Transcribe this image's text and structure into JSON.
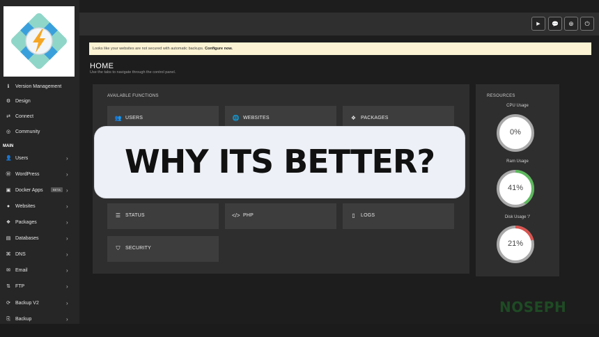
{
  "topbar": {
    "buttons": [
      {
        "icon": "youtube-icon",
        "glyph": "▶"
      },
      {
        "icon": "chat-icon",
        "glyph": "💬"
      },
      {
        "icon": "support-icon",
        "glyph": "⊕"
      },
      {
        "icon": "power-icon",
        "glyph": "⏻"
      }
    ]
  },
  "sidebar": {
    "top_items": [
      {
        "label": "Version Management",
        "icon": "info-icon",
        "glyph": "ℹ"
      },
      {
        "label": "Design",
        "icon": "gear-icon",
        "glyph": "⚙"
      },
      {
        "label": "Connect",
        "icon": "link-icon",
        "glyph": "⇄"
      },
      {
        "label": "Community",
        "icon": "comments-icon",
        "glyph": "◎"
      }
    ],
    "section_main": "MAIN",
    "main_items": [
      {
        "label": "Users",
        "icon": "users-icon",
        "glyph": "👤"
      },
      {
        "label": "WordPress",
        "icon": "wordpress-icon",
        "glyph": "Ⓦ"
      },
      {
        "label": "Docker Apps",
        "icon": "docker-icon",
        "glyph": "▣",
        "badge": "BETA"
      },
      {
        "label": "Websites",
        "icon": "globe-icon",
        "glyph": "●"
      },
      {
        "label": "Packages",
        "icon": "packages-icon",
        "glyph": "❖"
      },
      {
        "label": "Databases",
        "icon": "database-icon",
        "glyph": "▤"
      },
      {
        "label": "DNS",
        "icon": "dns-icon",
        "glyph": "⌘"
      },
      {
        "label": "Email",
        "icon": "email-icon",
        "glyph": "✉"
      },
      {
        "label": "FTP",
        "icon": "ftp-icon",
        "glyph": "⇅"
      },
      {
        "label": "Backup V2",
        "icon": "backup-icon",
        "glyph": "⟳"
      },
      {
        "label": "Backup",
        "icon": "backup-icon",
        "glyph": "⎘"
      }
    ]
  },
  "alert": {
    "text": "Looks like your websites are not secured with automatic backups.",
    "link": "Configure now."
  },
  "page": {
    "title": "HOME",
    "subtitle": "Use the tabs to navigate through the control panel."
  },
  "functions": {
    "title": "AVAILABLE FUNCTIONS",
    "cards": [
      {
        "label": "USERS",
        "icon": "users-icon",
        "glyph": "👥"
      },
      {
        "label": "WEBSITES",
        "icon": "globe-icon",
        "glyph": "🌐"
      },
      {
        "label": "PACKAGES",
        "icon": "packages-icon",
        "glyph": "❖"
      },
      {
        "label": "STATUS",
        "icon": "status-icon",
        "glyph": "☰"
      },
      {
        "label": "PHP",
        "icon": "code-icon",
        "glyph": "</>"
      },
      {
        "label": "LOGS",
        "icon": "file-icon",
        "glyph": "▯"
      },
      {
        "label": "SECURITY",
        "icon": "shield-icon",
        "glyph": "⛉"
      }
    ]
  },
  "resources": {
    "title": "RESOURCES",
    "gauges": [
      {
        "label": "CPU Usage",
        "value": "0%",
        "fraction": 0.0,
        "color": "#5cb85c"
      },
      {
        "label": "Ram Usage",
        "value": "41%",
        "fraction": 0.41,
        "color": "#5cb85c"
      },
      {
        "label": "Disk Usage '/'",
        "value": "21%",
        "fraction": 0.21,
        "color": "#d9534f"
      }
    ]
  },
  "banner": {
    "text": "WHY ITS BETTER?"
  },
  "watermark": {
    "text": "NOSEPH"
  }
}
